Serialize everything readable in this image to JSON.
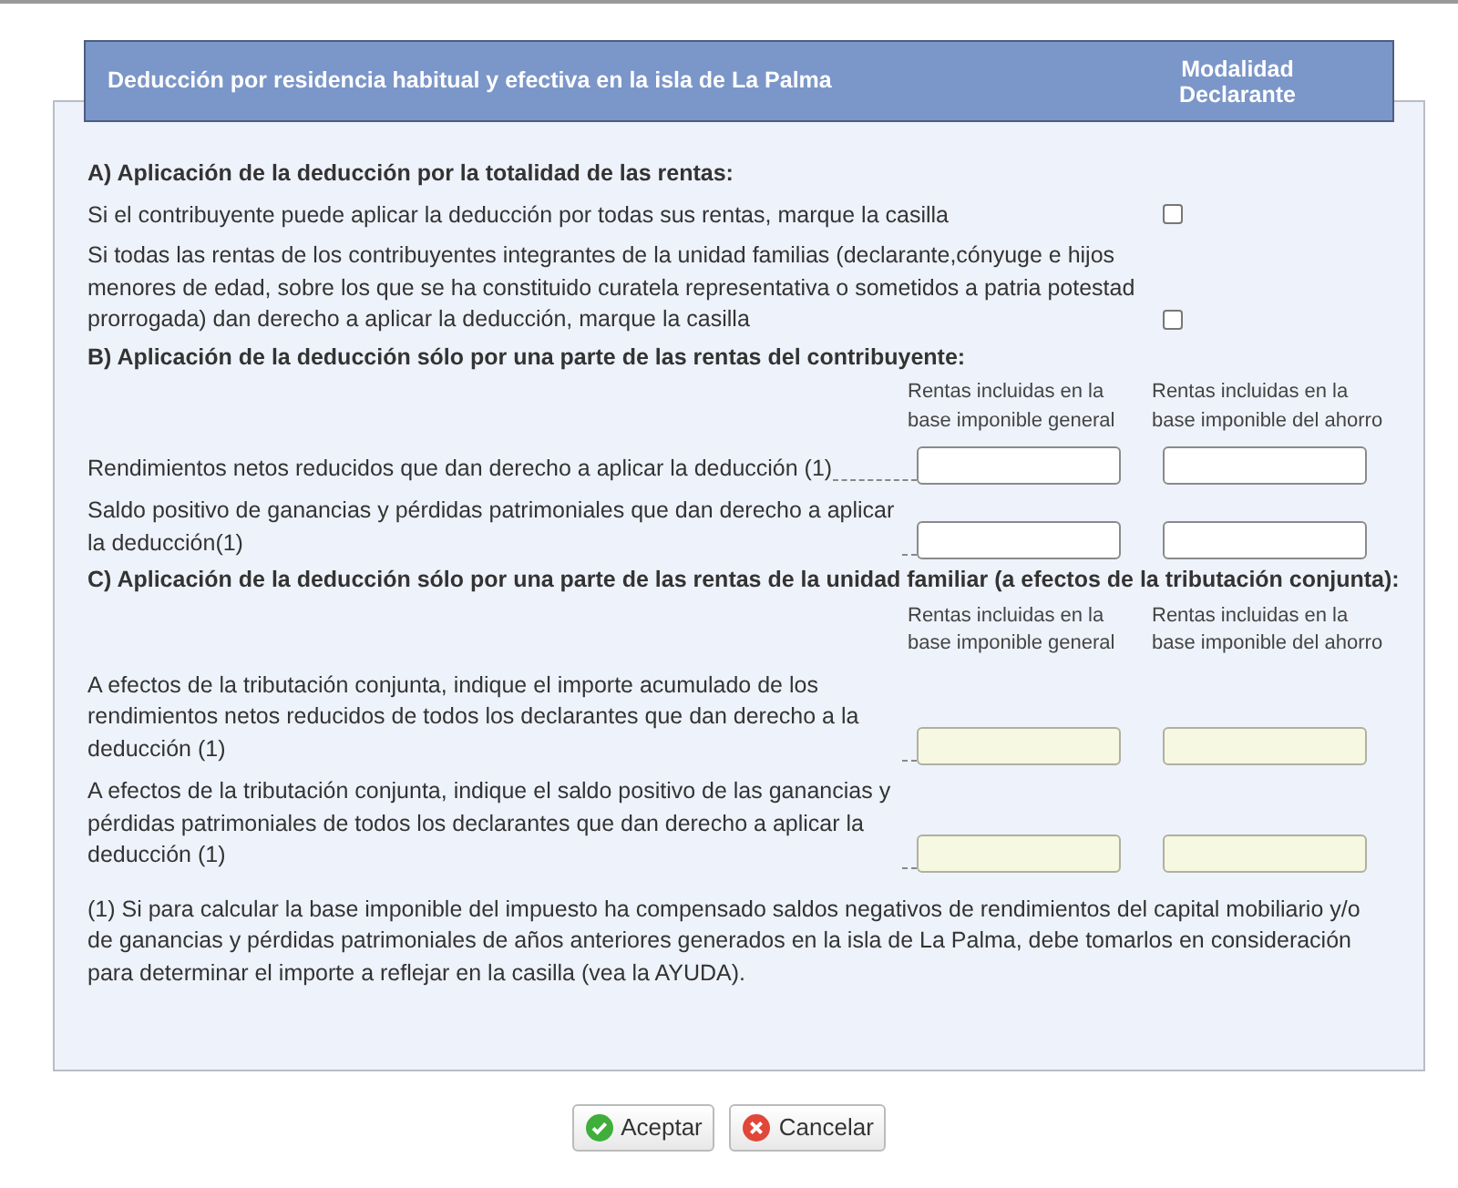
{
  "header": {
    "title": "Deducción por residencia habitual y efectiva en la isla de La Palma",
    "column_heading": "Modalidad Declarante"
  },
  "sections": [
    {
      "kind": "checkbox",
      "heading": "A) Aplicación de la deducción por la totalidad de las rentas:",
      "rows": [
        {
          "label": "Si el contribuyente puede aplicar la deducción por todas sus rentas, marque la casilla",
          "checked": false
        },
        {
          "label": "Si todas las rentas de los contribuyentes integrantes de la unidad familias (declarante,cónyuge e hijos menores de edad, sobre los que se ha constituido curatela representativa o sometidos a patria potestad prorrogada) dan derecho a aplicar la deducción, marque la casilla",
          "checked": false
        }
      ]
    },
    {
      "kind": "amounts",
      "heading": "B) Aplicación de la deducción sólo por una parte de las rentas del contribuyente:",
      "column_headings": [
        "Rentas incluidas en la base imponible general",
        "Rentas incluidas en la base imponible del ahorro"
      ],
      "rows": [
        {
          "label": "Rendimientos netos reducidos que dan derecho a aplicar la deducción (1)",
          "fields": [
            {
              "disabled": false
            },
            {
              "disabled": false
            }
          ]
        },
        {
          "label": "Saldo positivo de ganancias y pérdidas patrimoniales que dan derecho a aplicar la deducción(1)",
          "fields": [
            {
              "disabled": false
            },
            {
              "disabled": false
            }
          ]
        }
      ]
    },
    {
      "kind": "amounts",
      "heading": "C) Aplicación de la deducción sólo por una parte de las rentas de la unidad familiar (a efectos de la tributación conjunta):",
      "column_headings": [
        "Rentas incluidas en la base imponible general",
        "Rentas incluidas en la base imponible del ahorro"
      ],
      "rows": [
        {
          "label": "A efectos de la tributación conjunta, indique el importe acumulado de los rendimientos netos reducidos de todos los declarantes que dan derecho a la deducción (1)",
          "fields": [
            {
              "disabled": true
            },
            {
              "disabled": true
            }
          ]
        },
        {
          "label": "A efectos de la tributación conjunta, indique el saldo positivo de las ganancias y pérdidas patrimoniales de todos los declarantes que dan derecho a aplicar la deducción (1)",
          "fields": [
            {
              "disabled": true
            },
            {
              "disabled": true
            }
          ]
        }
      ]
    }
  ],
  "footnote": "(1) Si para calcular la base imponible del impuesto ha compensado saldos negativos de rendimientos del capital mobiliario y/o de ganancias y pérdidas patrimoniales de años anteriores generados en la isla de La Palma, debe tomarlos en consideración para determinar el importe a reflejar en la casilla (vea la AYUDA).",
  "buttons": [
    {
      "kind": "accept",
      "label": "Aceptar"
    },
    {
      "kind": "cancel",
      "label": "Cancelar"
    }
  ]
}
